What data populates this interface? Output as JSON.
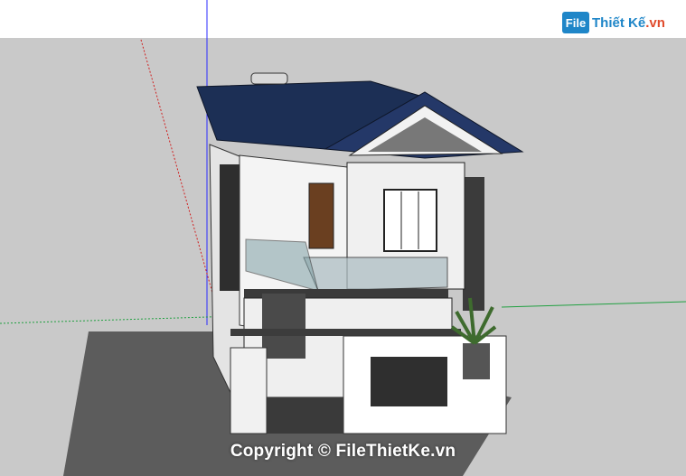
{
  "watermark": {
    "logo_icon_text": "File",
    "logo_name": "Thiết Kế",
    "logo_suffix": ".vn",
    "copyright": "Copyright © FileThietKe.vn"
  },
  "colors": {
    "sky": "#ffffff",
    "ground": "#c9c9c9",
    "base_slab": "#5c5c5c",
    "roof": "#1c2f55",
    "wall": "#f2f2f2",
    "dark_accent": "#3b3b3b",
    "axis_blue": "#2a2aff",
    "axis_red": "#d02020",
    "axis_green": "#20a040"
  }
}
